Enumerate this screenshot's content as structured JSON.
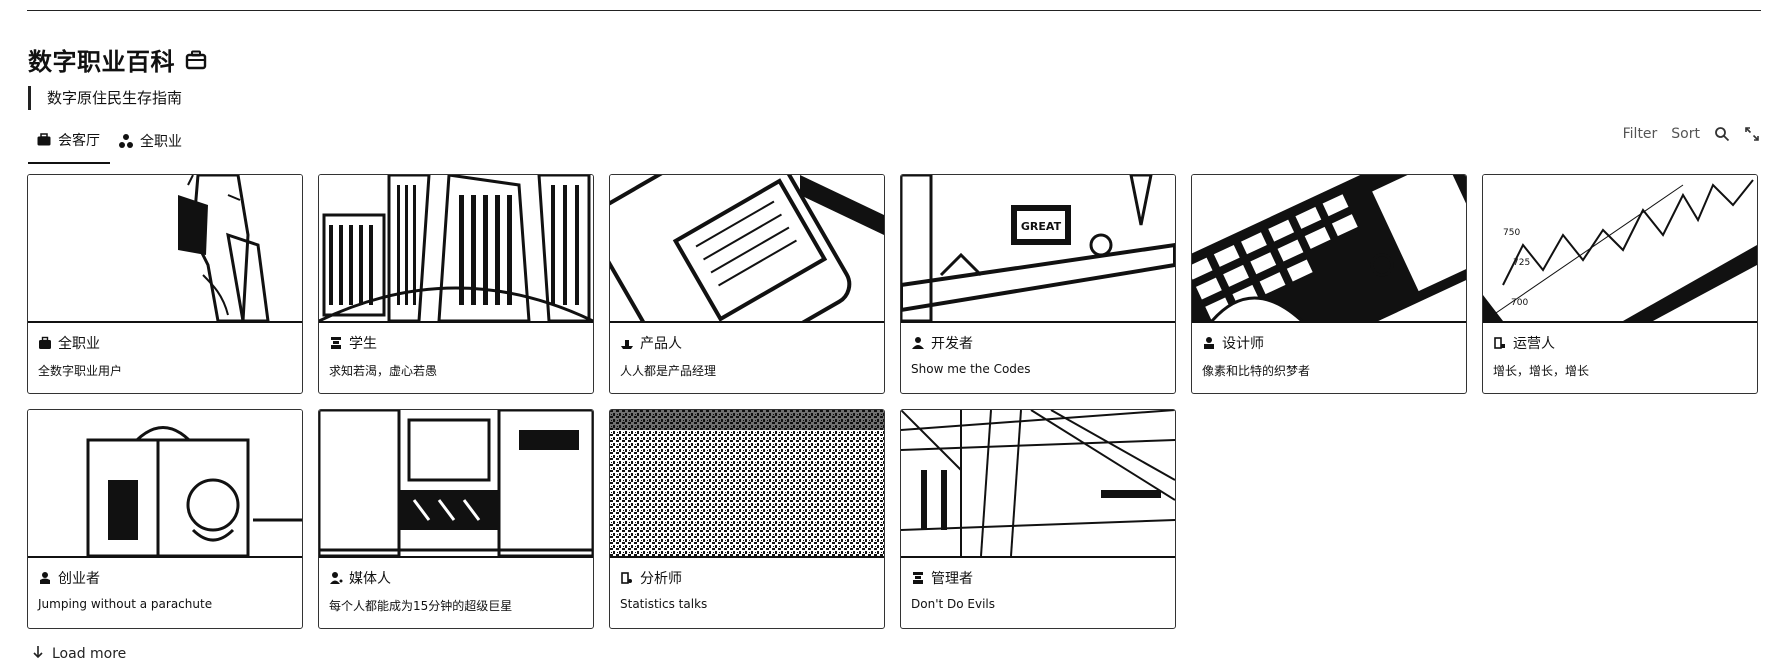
{
  "header": {
    "title": "数字职业百科",
    "title_icon": "briefcase-icon",
    "subtitle": "数字原住民生存指南"
  },
  "tabs": [
    {
      "label": "会客厅",
      "icon": "briefcase-icon",
      "active": true
    },
    {
      "label": "全职业",
      "icon": "grid-icon",
      "active": false
    }
  ],
  "toolbar": {
    "filter_label": "Filter",
    "sort_label": "Sort",
    "search_icon": "search-icon",
    "expand_icon": "expand-icon"
  },
  "cards": [
    {
      "title": "全职业",
      "desc": "全数字职业用户",
      "icon": "briefcase-icon"
    },
    {
      "title": "学生",
      "desc": "求知若渴，虚心若愚",
      "icon": "student-icon"
    },
    {
      "title": "产品人",
      "desc": "人人都是产品经理",
      "icon": "product-icon"
    },
    {
      "title": "开发者",
      "desc": "Show me the Codes",
      "icon": "developer-icon"
    },
    {
      "title": "设计师",
      "desc": "像素和比特的织梦者",
      "icon": "designer-icon"
    },
    {
      "title": "运营人",
      "desc": "增长，增长，增长",
      "icon": "operator-icon"
    },
    {
      "title": "创业者",
      "desc": "Jumping without a parachute",
      "icon": "founder-icon"
    },
    {
      "title": "媒体人",
      "desc": "每个人都能成为15分钟的超级巨星",
      "icon": "media-icon"
    },
    {
      "title": "分析师",
      "desc": "Statistics talks",
      "icon": "analyst-icon"
    },
    {
      "title": "管理者",
      "desc": "Don't Do Evils",
      "icon": "manager-icon"
    }
  ],
  "load_more": {
    "label": "Load more",
    "icon": "arrow-down-icon"
  },
  "colors": {
    "text": "#111111",
    "border": "#333333",
    "muted": "#555555",
    "background": "#ffffff"
  }
}
